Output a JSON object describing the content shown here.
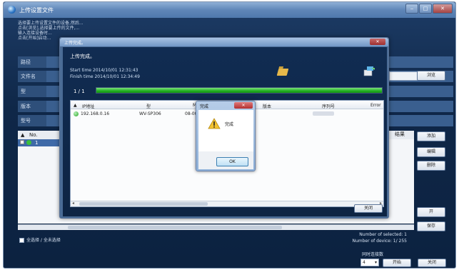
{
  "main_window": {
    "title": "上传设置文件",
    "description_lines": [
      "选择要上传设置文件的设备,然后...",
      "点击[浏览],选择要上传的文件,...",
      "输入连接设备时...",
      "点击[开始]启动..."
    ],
    "side_labels": [
      "路径",
      "文件名",
      "型",
      "版本",
      "型号"
    ],
    "list_header": {
      "no": "No.",
      "result": "结果"
    },
    "list_rows": [
      {
        "no": "1"
      }
    ],
    "side_buttons": [
      "浏览",
      "添加",
      "编辑",
      "删除",
      "开",
      "保存"
    ],
    "select_all_label": "全选择 / 全未选择",
    "number_of_selected": "Number of selected: 1",
    "number_of_device": "Number of device: 1/ 255",
    "concurrent_label": "同时连接数",
    "concurrent_value": "4",
    "start_label": "开始",
    "close_label": "关闭"
  },
  "upload_dialog": {
    "title": "上传完成。",
    "status": "上传完成。",
    "start_time": "Start time 2014/10/01 12:31:43",
    "finish_time": "Finish time 2014/10/01 12:34:49",
    "count": "1 / 1",
    "progress_fraction": 1.0,
    "columns": [
      "IP地址",
      "型",
      "MAC",
      "版本",
      "序列号",
      "Error"
    ],
    "rows": [
      {
        "ip": "192.168.0.16",
        "model": "WV-SP306",
        "mac": "08-00-"
      }
    ],
    "close_label": "关闭"
  },
  "message_box": {
    "title": "完成",
    "message": "完成",
    "ok_label": "OK"
  }
}
